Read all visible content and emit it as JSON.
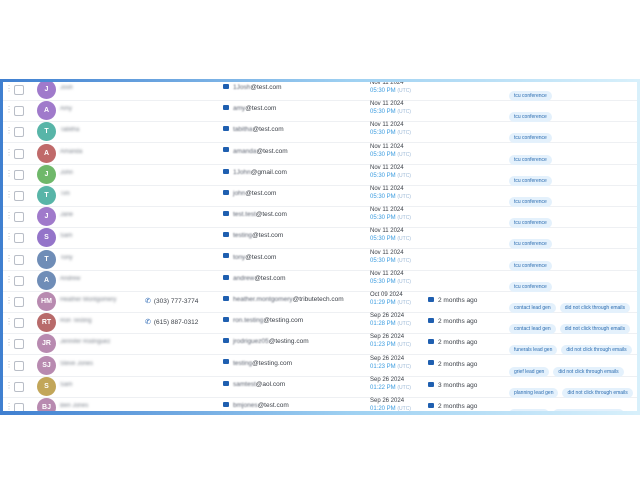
{
  "colors": {
    "purple": "#a07acb",
    "teal": "#58b5a8",
    "rose": "#c06a6a",
    "green": "#6fb86a",
    "violet": "#9474c9",
    "steel": "#6f8db7",
    "mauve": "#b88ab0",
    "brick": "#b86a6a",
    "mustard": "#c2a659",
    "link_blue": "#3b9ce0",
    "icon_blue": "#1f5fb0"
  },
  "rows": [
    {
      "initial": "J",
      "color": "#a07acb",
      "name": "Josh",
      "phone": "",
      "email_local": "1Josh",
      "email_domain": "@test.com",
      "date": "Nov 11 2024",
      "time": "05:30 PM",
      "tz": "(UTC)",
      "last": "",
      "tags": [
        "tcu conference"
      ]
    },
    {
      "initial": "A",
      "color": "#a07acb",
      "name": "Amy",
      "phone": "",
      "email_local": "amy",
      "email_domain": "@test.com",
      "date": "Nov 11 2024",
      "time": "05:30 PM",
      "tz": "(UTC)",
      "last": "",
      "tags": [
        "tcu conference"
      ]
    },
    {
      "initial": "T",
      "color": "#58b5a8",
      "name": "Tabitha",
      "phone": "",
      "email_local": "tabitha",
      "email_domain": "@test.com",
      "date": "Nov 11 2024",
      "time": "05:30 PM",
      "tz": "(UTC)",
      "last": "",
      "tags": [
        "tcu conference"
      ]
    },
    {
      "initial": "A",
      "color": "#c06a6a",
      "name": "Amanda",
      "phone": "",
      "email_local": "amanda",
      "email_domain": "@test.com",
      "date": "Nov 11 2024",
      "time": "05:30 PM",
      "tz": "(UTC)",
      "last": "",
      "tags": [
        "tcu conference"
      ]
    },
    {
      "initial": "J",
      "color": "#6fb86a",
      "name": "John",
      "phone": "",
      "email_local": "1John",
      "email_domain": "@gmail.com",
      "date": "Nov 11 2024",
      "time": "05:30 PM",
      "tz": "(UTC)",
      "last": "",
      "tags": [
        "tcu conference"
      ]
    },
    {
      "initial": "T",
      "color": "#58b5a8",
      "name": "Tim",
      "phone": "",
      "email_local": "john",
      "email_domain": "@test.com",
      "date": "Nov 11 2024",
      "time": "05:30 PM",
      "tz": "(UTC)",
      "last": "",
      "tags": [
        "tcu conference"
      ]
    },
    {
      "initial": "J",
      "color": "#a07acb",
      "name": "Jane",
      "phone": "",
      "email_local": "test.test",
      "email_domain": "@test.com",
      "date": "Nov 11 2024",
      "time": "05:30 PM",
      "tz": "(UTC)",
      "last": "",
      "tags": [
        "tcu conference"
      ]
    },
    {
      "initial": "S",
      "color": "#9474c9",
      "name": "Sam",
      "phone": "",
      "email_local": "testing",
      "email_domain": "@test.com",
      "date": "Nov 11 2024",
      "time": "05:30 PM",
      "tz": "(UTC)",
      "last": "",
      "tags": [
        "tcu conference"
      ]
    },
    {
      "initial": "T",
      "color": "#6f8db7",
      "name": "Tony",
      "phone": "",
      "email_local": "tony",
      "email_domain": "@test.com",
      "date": "Nov 11 2024",
      "time": "05:30 PM",
      "tz": "(UTC)",
      "last": "",
      "tags": [
        "tcu conference"
      ]
    },
    {
      "initial": "A",
      "color": "#6f8db7",
      "name": "Andrew",
      "phone": "",
      "email_local": "andrew",
      "email_domain": "@test.com",
      "date": "Nov 11 2024",
      "time": "05:30 PM",
      "tz": "(UTC)",
      "last": "",
      "tags": [
        "tcu conference"
      ]
    },
    {
      "initial": "HM",
      "color": "#b88ab0",
      "name": "Heather Montgomery",
      "phone": "(303) 777-3774",
      "email_local": "heather.montgomery",
      "email_domain": "@tributetech.com",
      "date": "Oct 09 2024",
      "time": "01:29 PM",
      "tz": "(UTC)",
      "last": "2 months ago",
      "tags": [
        "contact lead gen",
        "did not click through emails"
      ]
    },
    {
      "initial": "RT",
      "color": "#b86a6a",
      "name": "Ron Testing",
      "phone": "(615) 887-0312",
      "email_local": "ron.testing",
      "email_domain": "@testing.com",
      "date": "Sep 26 2024",
      "time": "01:28 PM",
      "tz": "(UTC)",
      "last": "2 months ago",
      "tags": [
        "contact lead gen",
        "did not click through emails"
      ]
    },
    {
      "initial": "JR",
      "color": "#b88ab0",
      "name": "Jennifer Rodriguez",
      "phone": "",
      "email_local": "jrodriguez05",
      "email_domain": "@testing.com",
      "date": "Sep 26 2024",
      "time": "01:23 PM",
      "tz": "(UTC)",
      "last": "2 months ago",
      "tags": [
        "funerals lead gen",
        "did not click through emails"
      ]
    },
    {
      "initial": "SJ",
      "color": "#b88ab0",
      "name": "Steve Jones",
      "phone": "",
      "email_local": "testing",
      "email_domain": "@testing.com",
      "date": "Sep 26 2024",
      "time": "01:23 PM",
      "tz": "(UTC)",
      "last": "2 months ago",
      "tags": [
        "grief lead gen",
        "did not click through emails"
      ]
    },
    {
      "initial": "S",
      "color": "#c2a659",
      "name": "Sam",
      "phone": "",
      "email_local": "samtest",
      "email_domain": "@aol.com",
      "date": "Sep 26 2024",
      "time": "01:22 PM",
      "tz": "(UTC)",
      "last": "3 months ago",
      "tags": [
        "planning lead gen",
        "did not click through emails"
      ]
    },
    {
      "initial": "BJ",
      "color": "#b88ab0",
      "name": "Ben Jones",
      "phone": "",
      "email_local": "bmjones",
      "email_domain": "@test.com",
      "date": "Sep 26 2024",
      "time": "01:20 PM",
      "tz": "(UTC)",
      "last": "2 months ago",
      "tags": [
        "grief lead gen",
        "did not click through emails"
      ]
    }
  ]
}
